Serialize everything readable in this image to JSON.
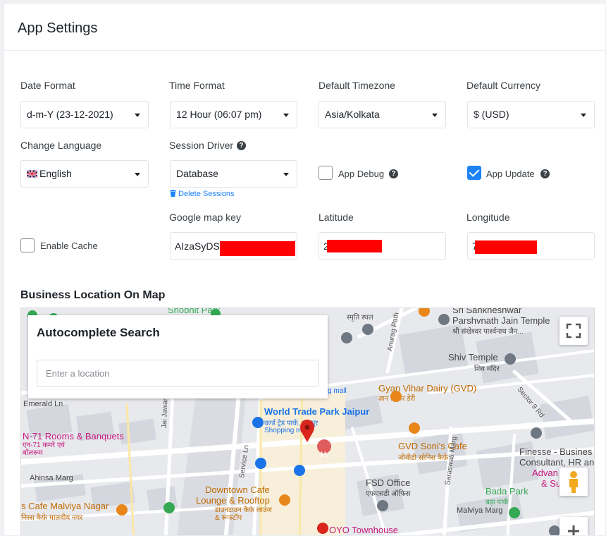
{
  "header": {
    "title": "App Settings"
  },
  "fields": {
    "date_format": {
      "label": "Date Format",
      "value": "d-m-Y (23-12-2021)"
    },
    "time_format": {
      "label": "Time Format",
      "value": "12 Hour (06:07 pm)"
    },
    "default_timezone": {
      "label": "Default Timezone",
      "value": "Asia/Kolkata"
    },
    "default_currency": {
      "label": "Default Currency",
      "value": "$ (USD)"
    },
    "change_language": {
      "label": "Change Language",
      "value": "English"
    },
    "session_driver": {
      "label": "Session Driver",
      "value": "Database",
      "delete_link": "Delete Sessions"
    },
    "app_debug": {
      "label": "App Debug",
      "checked": false
    },
    "app_update": {
      "label": "App Update",
      "checked": true
    },
    "enable_cache": {
      "label": "Enable Cache",
      "checked": false
    },
    "google_map_key": {
      "label": "Google map key",
      "value": "AIzaSyDS"
    },
    "latitude": {
      "label": "Latitude",
      "value": "2"
    },
    "longitude": {
      "label": "Longitude",
      "value": "7"
    }
  },
  "map": {
    "section_title": "Business Location On Map",
    "autocomplete": {
      "title": "Autocomplete Search",
      "placeholder": "Enter a location"
    },
    "places": {
      "shobhit_park": "Shobhit Park",
      "sri_sankheshwar": "Sri Sankheshwar",
      "parshvnath": "Parshvnath Jain Temple",
      "parshvnath_hi": "श्री संखेश्वर पार्श्वनाथ जैन...",
      "smriti_sthal": "स्मृति स्थल",
      "anurag_path": "Anurag Path",
      "shiv_temple": "Shiv Temple",
      "shiv_temple_hi": "शिव मंदिर",
      "gyan_vihar": "Gyan Vihar Dairy (GVD)",
      "gyan_vihar_hi": "ज्ञान विहार डेरी",
      "sector_9": "Sector 9 Rd",
      "emerald": "Emerald Ln",
      "jai_jawan": "Jai Jawan Path",
      "wtp": "World Trade Park Jaipur",
      "wtp_hi": "वर्ल्ड ट्रेड पार्क, जयपुर",
      "wtp_shopping": "Shopping mall",
      "mall_fragment": "g mall",
      "n71": "N-71 Rooms & Banquets",
      "n71_hi": "एन-71 कमरे एवं बॉलरूम",
      "service_ln": "Service Ln",
      "gvd_sonis": "GVD Soni's Cafe",
      "gvd_sonis_hi": "जीवीडी सोनिस कैफ़े",
      "finesse": "Finesse - Busines",
      "finesse2": "Consultant, HR an",
      "advan": "Advan",
      "su": "& Su",
      "ahinsa": "Ahinsa Marg",
      "fsd": "FSD Office",
      "fsd_hi": "एफएसडी ऑफिस",
      "bada_park": "Bada Park",
      "bada_park_hi": "बड़ा पार्क",
      "downtown": "Downtown Cafe",
      "downtown2": "Lounge & Rooftop",
      "downtown_hi": "डाउनटाउन कैफ़े लाउंज & रूफटॉप",
      "saraswati": "Saraswati Marg",
      "malviya_marg": "Malviya Marg",
      "cafe_malviya": "s Cafe Malviya Nagar",
      "cafe_malviya_hi": "निस्स कैफ़े मालवीय नगर",
      "oyo": "OYO Townhouse"
    }
  },
  "colors": {
    "accent": "#1d82f5",
    "marker": "#d9251c",
    "poi_orange": "#e8861a",
    "poi_blue": "#1a73e8",
    "poi_pink": "#c5197d",
    "park_green": "#34a853",
    "poi_gray": "#6f7782"
  },
  "icons": {
    "help": "?",
    "trash": "trash-icon",
    "flag": "uk-flag-icon"
  }
}
